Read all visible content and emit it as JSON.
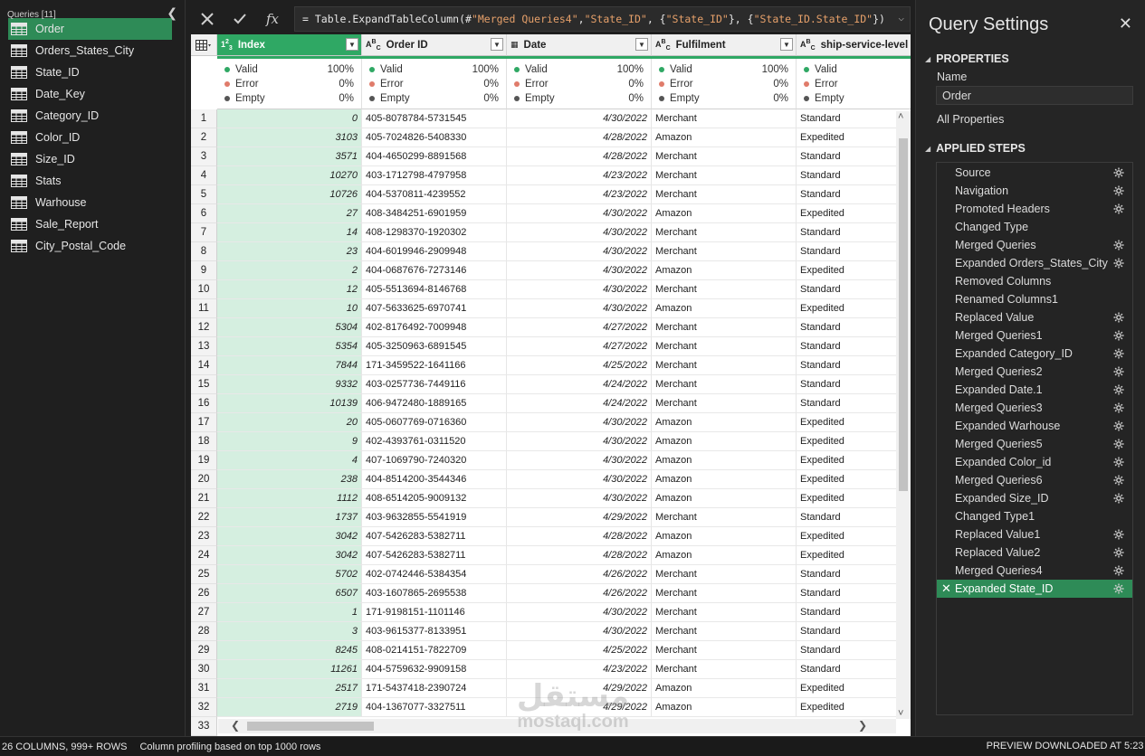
{
  "queries": {
    "header": "Queries [11]",
    "items": [
      "Order",
      "Orders_States_City",
      "State_ID",
      "Date_Key",
      "Category_ID",
      "Color_ID",
      "Size_ID",
      "Stats",
      "Warhouse",
      "Sale_Report",
      "City_Postal_Code"
    ],
    "selected": 0
  },
  "formula": {
    "cancel_icon": "close-icon",
    "accept_icon": "check-icon",
    "fx_label": "fx",
    "prefix": "= Table.ExpandTableColumn(#",
    "s1": "\"Merged Queries4\"",
    "mid1": ", ",
    "s2": "\"State_ID\"",
    "mid2": ", {",
    "s3": "\"State_ID\"",
    "mid3": "}, {",
    "s4": "\"State_ID.State_ID\"",
    "suffix": "})",
    "expand_icon": "chevron-down-icon"
  },
  "columns": [
    {
      "type": "1²3",
      "name": "Index"
    },
    {
      "type": "A^B_C",
      "name": "Order ID"
    },
    {
      "type": "▦",
      "name": "Date"
    },
    {
      "type": "A^B_C",
      "name": "Fulfilment"
    },
    {
      "type": "A^B_C",
      "name": "ship-service-level"
    }
  ],
  "profile": {
    "labels": [
      "Valid",
      "Error",
      "Empty"
    ],
    "values": [
      "100%",
      "0%",
      "0%"
    ],
    "colors": [
      "#2fa864",
      "#e07b6a",
      "#555555"
    ]
  },
  "rows": [
    [
      "0",
      "405-8078784-5731545",
      "4/30/2022",
      "Merchant",
      "Standard"
    ],
    [
      "3103",
      "405-7024826-5408330",
      "4/28/2022",
      "Amazon",
      "Expedited"
    ],
    [
      "3571",
      "404-4650299-8891568",
      "4/28/2022",
      "Merchant",
      "Standard"
    ],
    [
      "10270",
      "403-1712798-4797958",
      "4/23/2022",
      "Merchant",
      "Standard"
    ],
    [
      "10726",
      "404-5370811-4239552",
      "4/23/2022",
      "Merchant",
      "Standard"
    ],
    [
      "27",
      "408-3484251-6901959",
      "4/30/2022",
      "Amazon",
      "Expedited"
    ],
    [
      "14",
      "408-1298370-1920302",
      "4/30/2022",
      "Merchant",
      "Standard"
    ],
    [
      "23",
      "404-6019946-2909948",
      "4/30/2022",
      "Merchant",
      "Standard"
    ],
    [
      "2",
      "404-0687676-7273146",
      "4/30/2022",
      "Amazon",
      "Expedited"
    ],
    [
      "12",
      "405-5513694-8146768",
      "4/30/2022",
      "Merchant",
      "Standard"
    ],
    [
      "10",
      "407-5633625-6970741",
      "4/30/2022",
      "Amazon",
      "Expedited"
    ],
    [
      "5304",
      "402-8176492-7009948",
      "4/27/2022",
      "Merchant",
      "Standard"
    ],
    [
      "5354",
      "405-3250963-6891545",
      "4/27/2022",
      "Merchant",
      "Standard"
    ],
    [
      "7844",
      "171-3459522-1641166",
      "4/25/2022",
      "Merchant",
      "Standard"
    ],
    [
      "9332",
      "403-0257736-7449116",
      "4/24/2022",
      "Merchant",
      "Standard"
    ],
    [
      "10139",
      "406-9472480-1889165",
      "4/24/2022",
      "Merchant",
      "Standard"
    ],
    [
      "20",
      "405-0607769-0716360",
      "4/30/2022",
      "Amazon",
      "Expedited"
    ],
    [
      "9",
      "402-4393761-0311520",
      "4/30/2022",
      "Amazon",
      "Expedited"
    ],
    [
      "4",
      "407-1069790-7240320",
      "4/30/2022",
      "Amazon",
      "Expedited"
    ],
    [
      "238",
      "404-8514200-3544346",
      "4/30/2022",
      "Amazon",
      "Expedited"
    ],
    [
      "1112",
      "408-6514205-9009132",
      "4/30/2022",
      "Amazon",
      "Expedited"
    ],
    [
      "1737",
      "403-9632855-5541919",
      "4/29/2022",
      "Merchant",
      "Standard"
    ],
    [
      "3042",
      "407-5426283-5382711",
      "4/28/2022",
      "Amazon",
      "Expedited"
    ],
    [
      "3042",
      "407-5426283-5382711",
      "4/28/2022",
      "Amazon",
      "Expedited"
    ],
    [
      "5702",
      "402-0742446-5384354",
      "4/26/2022",
      "Merchant",
      "Standard"
    ],
    [
      "6507",
      "403-1607865-2695538",
      "4/26/2022",
      "Merchant",
      "Standard"
    ],
    [
      "1",
      "171-9198151-1101146",
      "4/30/2022",
      "Merchant",
      "Standard"
    ],
    [
      "3",
      "403-9615377-8133951",
      "4/30/2022",
      "Merchant",
      "Standard"
    ],
    [
      "8245",
      "408-0214151-7822709",
      "4/25/2022",
      "Merchant",
      "Standard"
    ],
    [
      "11261",
      "404-5759632-9909158",
      "4/23/2022",
      "Merchant",
      "Standard"
    ],
    [
      "2517",
      "171-5437418-2390724",
      "4/29/2022",
      "Amazon",
      "Expedited"
    ],
    [
      "2719",
      "404-1367077-3327511",
      "4/29/2022",
      "Amazon",
      "Expedited"
    ]
  ],
  "extra_row_number": "33",
  "settings": {
    "title": "Query Settings",
    "properties_label": "PROPERTIES",
    "name_label": "Name",
    "name_value": "Order",
    "all_properties": "All Properties",
    "applied_steps_label": "APPLIED STEPS",
    "steps": [
      {
        "name": "Source",
        "gear": true
      },
      {
        "name": "Navigation",
        "gear": true
      },
      {
        "name": "Promoted Headers",
        "gear": true
      },
      {
        "name": "Changed Type",
        "gear": false
      },
      {
        "name": "Merged Queries",
        "gear": true
      },
      {
        "name": "Expanded Orders_States_City",
        "gear": true
      },
      {
        "name": "Removed Columns",
        "gear": false
      },
      {
        "name": "Renamed Columns1",
        "gear": false
      },
      {
        "name": "Replaced Value",
        "gear": true
      },
      {
        "name": "Merged Queries1",
        "gear": true
      },
      {
        "name": "Expanded Category_ID",
        "gear": true
      },
      {
        "name": "Merged Queries2",
        "gear": true
      },
      {
        "name": "Expanded Date.1",
        "gear": true
      },
      {
        "name": "Merged Queries3",
        "gear": true
      },
      {
        "name": "Expanded Warhouse",
        "gear": true
      },
      {
        "name": "Merged Queries5",
        "gear": true
      },
      {
        "name": "Expanded Color_id",
        "gear": true
      },
      {
        "name": "Merged Queries6",
        "gear": true
      },
      {
        "name": "Expanded Size_ID",
        "gear": true
      },
      {
        "name": "Changed Type1",
        "gear": false
      },
      {
        "name": "Replaced Value1",
        "gear": true
      },
      {
        "name": "Replaced Value2",
        "gear": true
      },
      {
        "name": "Merged Queries4",
        "gear": true
      },
      {
        "name": "Expanded State_ID",
        "gear": true
      }
    ],
    "selected_step": 23
  },
  "status": {
    "left": "26 COLUMNS, 999+ ROWS",
    "profiling": "Column profiling based on top 1000 rows",
    "right": "PREVIEW DOWNLOADED AT 5:23 PM"
  },
  "watermark": {
    "arabic": "مستقل",
    "latin": "mostaql.com"
  },
  "colors": {
    "accent": "#2e8b57",
    "header_selected": "#2fa864",
    "index_cells": "#d5efe0"
  }
}
